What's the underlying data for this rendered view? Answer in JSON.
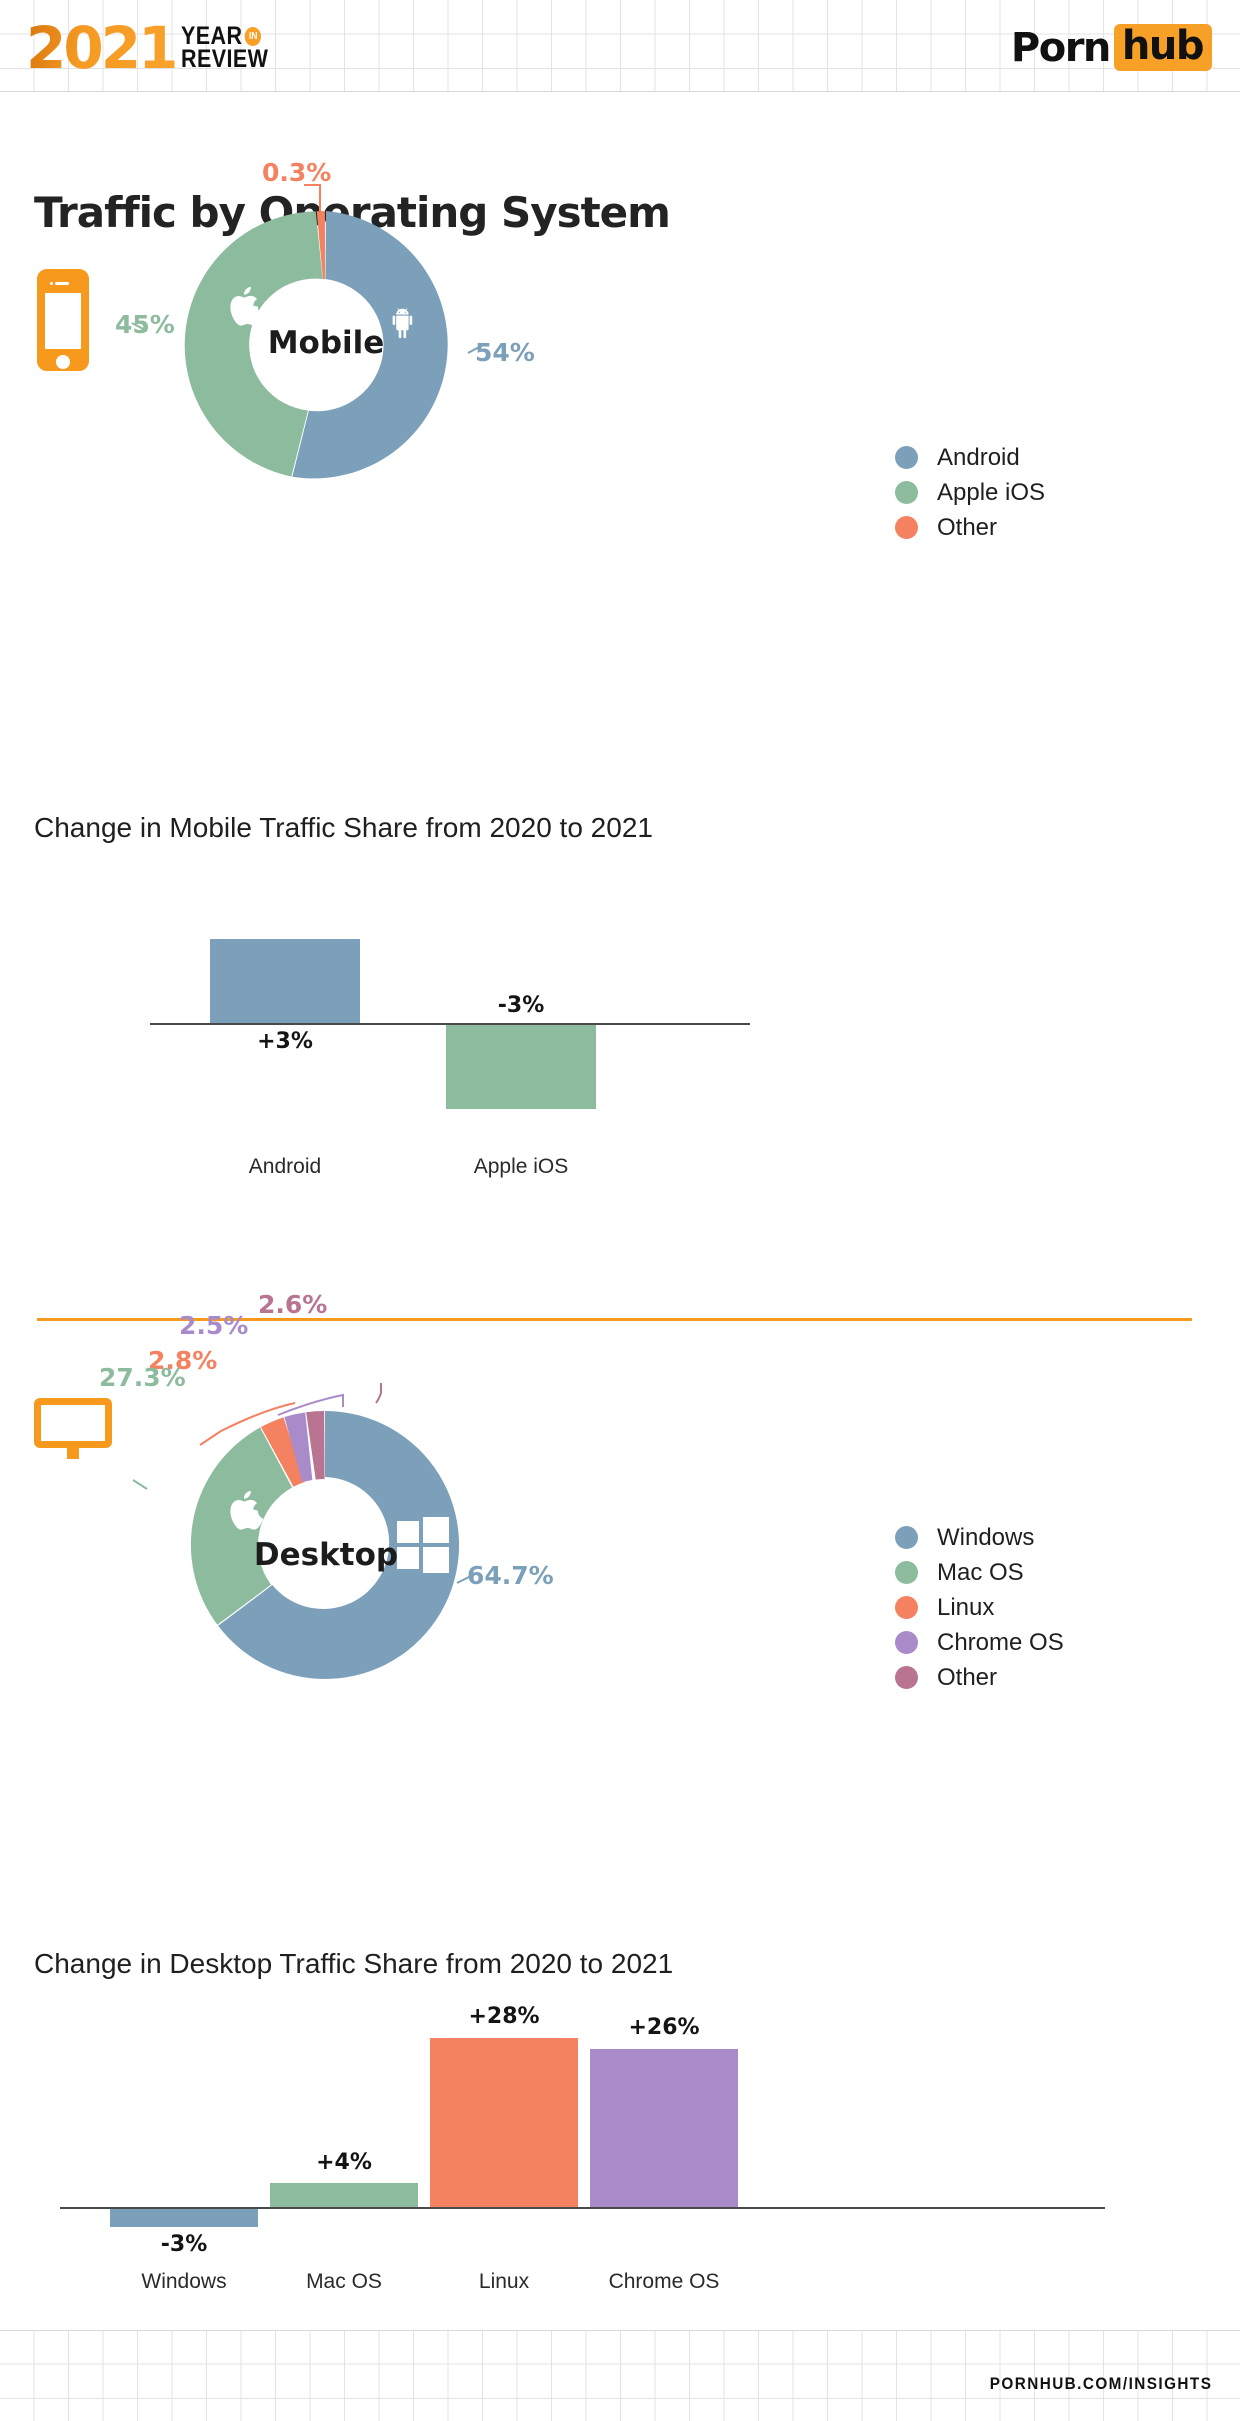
{
  "header": {
    "year": "2021",
    "year_word": "YEAR",
    "in_badge": "IN",
    "review_word": "REVIEW",
    "brand_first": "Porn",
    "brand_second": "hub"
  },
  "page_title": "Traffic by Operating System",
  "footer": {
    "url": "PORNHUB.COM/INSIGHTS"
  },
  "colors": {
    "blue": "#7C9FBA",
    "green": "#8DBB9E",
    "salmon": "#F4815F",
    "purple": "#A98BC9",
    "mauve": "#B87490",
    "orange": "#F7991C",
    "axis": "#4a4a4a"
  },
  "mobile": {
    "device_icon": "phone-icon",
    "center_label": "Mobile",
    "legend": [
      {
        "label": "Android",
        "color": "#7C9FBA"
      },
      {
        "label": "Apple iOS",
        "color": "#8DBB9E"
      },
      {
        "label": "Other",
        "color": "#F4815F"
      }
    ],
    "change_title": "Change in Mobile Traffic Share from 2020 to 2021"
  },
  "desktop": {
    "device_icon": "monitor-icon",
    "center_label": "Desktop",
    "legend": [
      {
        "label": "Windows",
        "color": "#7C9FBA"
      },
      {
        "label": "Mac OS",
        "color": "#8DBB9E"
      },
      {
        "label": "Linux",
        "color": "#F4815F"
      },
      {
        "label": "Chrome OS",
        "color": "#A98BC9"
      },
      {
        "label": "Other",
        "color": "#B87490"
      }
    ],
    "change_title": "Change in Desktop Traffic Share from 2020 to 2021"
  },
  "chart_data": [
    {
      "type": "pie",
      "id": "mobile-os-share",
      "title": "Mobile",
      "labels": [
        "Android",
        "Apple iOS",
        "Other"
      ],
      "values": [
        54,
        45,
        0.3
      ],
      "value_labels": [
        "54%",
        "45%",
        "0.3%"
      ],
      "colors": [
        "#7C9FBA",
        "#8DBB9E",
        "#F4815F"
      ],
      "donut": true,
      "legend_position": "right"
    },
    {
      "type": "bar",
      "id": "mobile-share-change",
      "title": "Change in Mobile Traffic Share from 2020 to 2021",
      "categories": [
        "Android",
        "Apple iOS"
      ],
      "values": [
        3,
        -3
      ],
      "value_labels": [
        "+3%",
        "-3%"
      ],
      "colors": [
        "#7C9FBA",
        "#8DBB9E"
      ],
      "xlabel": "",
      "ylabel": "",
      "ylim": [
        -4,
        4
      ],
      "grid": false,
      "zero_axis": true
    },
    {
      "type": "pie",
      "id": "desktop-os-share",
      "title": "Desktop",
      "labels": [
        "Windows",
        "Mac OS",
        "Linux",
        "Chrome OS",
        "Other"
      ],
      "values": [
        64.7,
        27.3,
        2.8,
        2.5,
        2.6
      ],
      "value_labels": [
        "64.7%",
        "27.3%",
        "2.8%",
        "2.5%",
        "2.6%"
      ],
      "colors": [
        "#7C9FBA",
        "#8DBB9E",
        "#F4815F",
        "#A98BC9",
        "#B87490"
      ],
      "donut": true,
      "legend_position": "right"
    },
    {
      "type": "bar",
      "id": "desktop-share-change",
      "title": "Change in Desktop Traffic Share from 2020 to 2021",
      "categories": [
        "Windows",
        "Mac OS",
        "Linux",
        "Chrome OS"
      ],
      "values": [
        -3,
        4,
        28,
        26
      ],
      "value_labels": [
        "-3%",
        "+4%",
        "+28%",
        "+26%"
      ],
      "colors": [
        "#7C9FBA",
        "#8DBB9E",
        "#F4815F",
        "#A98BC9"
      ],
      "xlabel": "",
      "ylabel": "",
      "ylim": [
        -6,
        30
      ],
      "grid": false,
      "zero_axis": true
    }
  ]
}
